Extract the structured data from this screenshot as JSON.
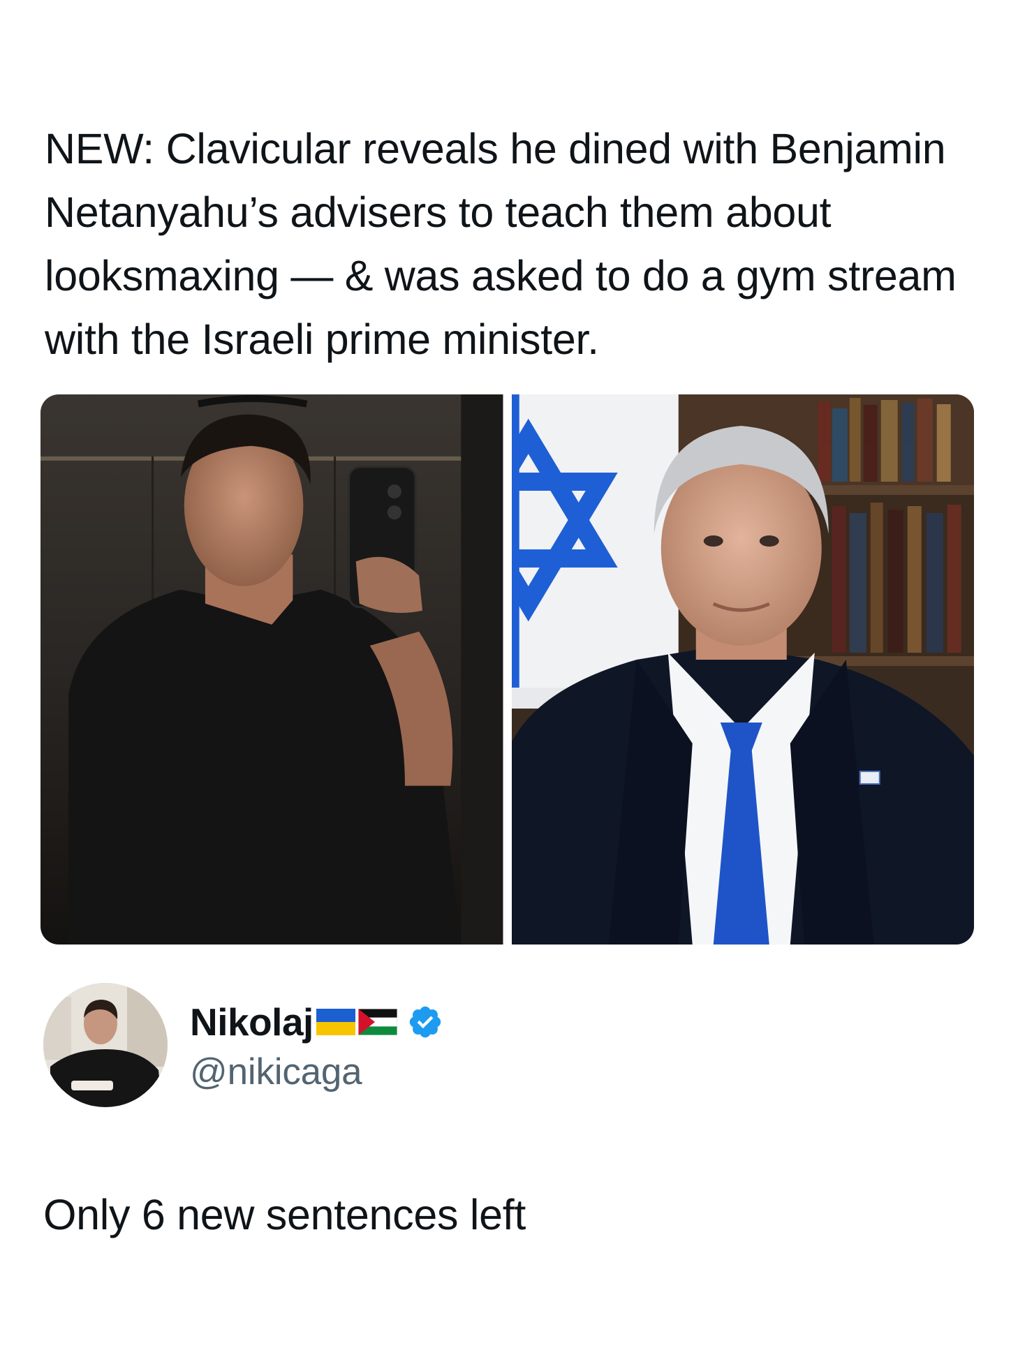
{
  "quoted_post": {
    "text": "NEW: Clavicular reveals he dined with Benjamin Netanyahu’s advisers to teach them about looksmaxing — & was asked to do a gym stream with the Israeli prime minister.",
    "media": [
      {
        "subject": "man-selfie-photo"
      },
      {
        "subject": "portrait-photo-with-flag"
      }
    ]
  },
  "author": {
    "display_name": "Nikolaj",
    "flags": [
      "ukraine-flag-icon",
      "palestine-flag-icon"
    ],
    "verified_icon": "verified-badge-icon",
    "handle": "@nikicaga",
    "avatar_icon": "avatar"
  },
  "post": {
    "text": "Only 6 new sentences left"
  },
  "colors": {
    "text_primary": "#0f1419",
    "text_secondary": "#536471",
    "verified_blue": "#1d9bf0",
    "background": "#ffffff"
  }
}
